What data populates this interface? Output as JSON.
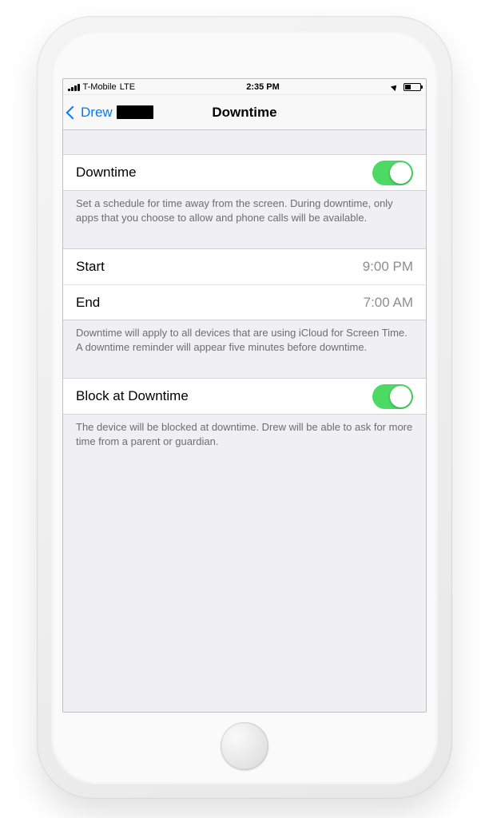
{
  "statusBar": {
    "carrier": "T-Mobile",
    "network": "LTE",
    "time": "2:35 PM"
  },
  "nav": {
    "backLabel": "Drew",
    "title": "Downtime"
  },
  "rows": {
    "downtime": {
      "label": "Downtime",
      "enabled": true
    },
    "start": {
      "label": "Start",
      "value": "9:00 PM"
    },
    "end": {
      "label": "End",
      "value": "7:00 AM"
    },
    "block": {
      "label": "Block at Downtime",
      "enabled": true
    }
  },
  "footers": {
    "downtime": "Set a schedule for time away from the screen. During downtime, only apps that you choose to allow and phone calls will be available.",
    "schedule": "Downtime will apply to all devices that are using iCloud for Screen Time. A downtime reminder will appear five minutes before downtime.",
    "block": "The device will be blocked at downtime. Drew will be able to ask for more time from a parent or guardian."
  }
}
